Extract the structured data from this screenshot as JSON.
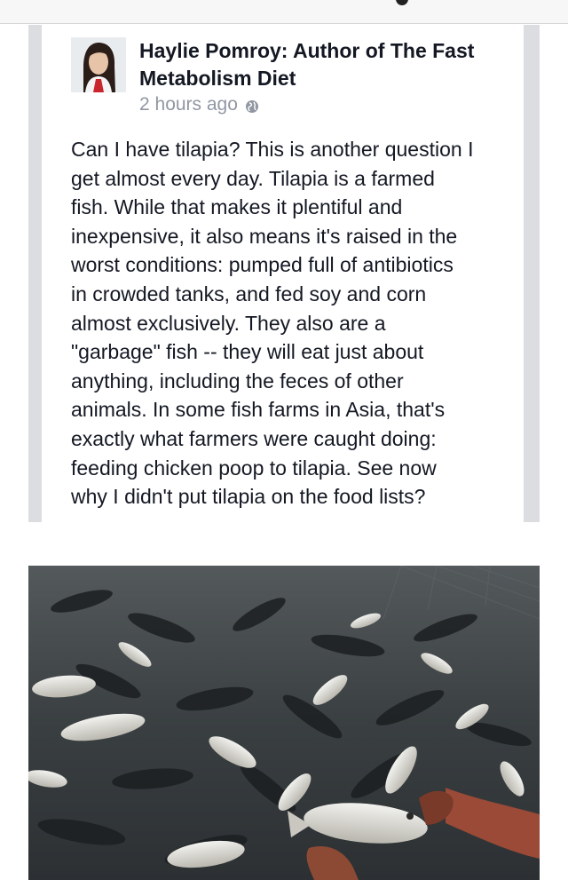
{
  "post": {
    "author_name": "Haylie Pomroy: Author of The Fast Metabolism Diet",
    "timestamp": "2 hours ago",
    "privacy_icon": "globe-icon",
    "text": "Can I have tilapia? This is another question I\nget almost every day. Tilapia is a farmed\nfish. While that makes it plentiful and\ninexpensive, it also means it's raised in the\nworst conditions: pumped full of antibiotics\nin crowded tanks, and fed soy and corn\nalmost exclusively. They also are a\n\"garbage\" fish -- they will eat just about\nanything, including the feces of other\nanimals. In some fish farms in Asia, that's\nexactly what farmers were caught doing:\nfeeding chicken poop to tilapia. See now\nwhy I didn't put tilapia on the food lists?"
  },
  "colors": {
    "author_text": "#141823",
    "meta_text": "#9197a3",
    "side_rail": "#dcdde1"
  }
}
